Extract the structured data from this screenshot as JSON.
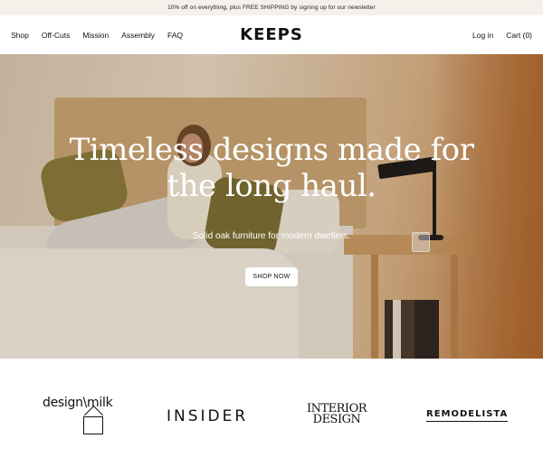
{
  "announcement": {
    "text": "10% off on everything, plus FREE SHIPPING by signing up for our newsletter"
  },
  "nav": {
    "left_items": [
      {
        "label": "Shop"
      },
      {
        "label": "Off-Cuts"
      },
      {
        "label": "Mission"
      },
      {
        "label": "Assembly"
      },
      {
        "label": "FAQ"
      }
    ],
    "logo": "KEEPS",
    "login_label": "Log in",
    "cart_label": "Cart (0)"
  },
  "hero": {
    "title_line1": "Timeless designs made for",
    "title_line2": "the long haul.",
    "subtitle": "Solid oak furniture for modern dwellers.",
    "cta_label": "SHOP NOW"
  },
  "press": {
    "logos": [
      {
        "label": "design\\milk",
        "icon": "milk-carton-icon"
      },
      {
        "label": "INSIDER"
      },
      {
        "label_line1": "INTERIOR",
        "label_line2": "DESIGN"
      },
      {
        "label": "REMODELISTA"
      }
    ]
  },
  "colors": {
    "announcement_bg": "#f4f1ea",
    "button_bg": "#ffffff",
    "hero_text": "#ffffff"
  }
}
